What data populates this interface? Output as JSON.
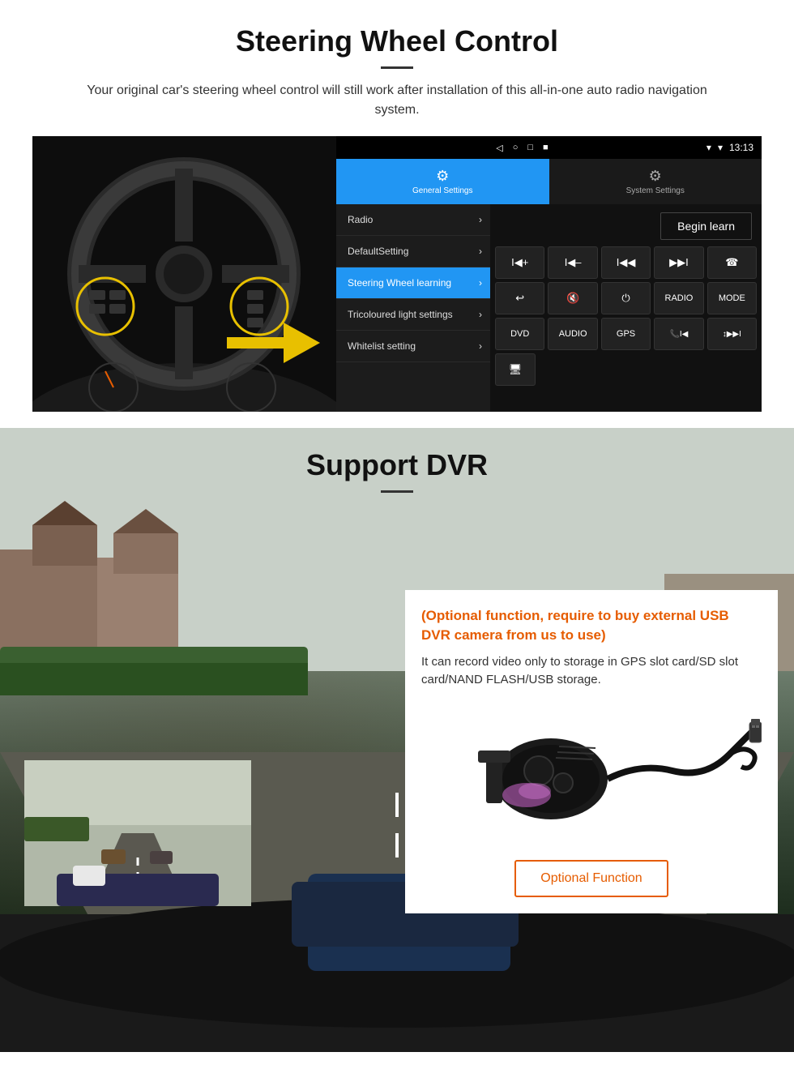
{
  "page": {
    "section1": {
      "title": "Steering Wheel Control",
      "description": "Your original car's steering wheel control will still work after installation of this all-in-one auto radio navigation system.",
      "statusbar": {
        "time": "13:13",
        "nav_icons": [
          "◁",
          "○",
          "□",
          "■"
        ]
      },
      "tabs": [
        {
          "label": "General Settings",
          "icon": "⚙",
          "active": true
        },
        {
          "label": "System Settings",
          "icon": "🔧",
          "active": false
        }
      ],
      "menu_items": [
        {
          "label": "Radio",
          "active": false
        },
        {
          "label": "DefaultSetting",
          "active": false
        },
        {
          "label": "Steering Wheel learning",
          "active": true
        },
        {
          "label": "Tricoloured light settings",
          "active": false
        },
        {
          "label": "Whitelist setting",
          "active": false
        }
      ],
      "begin_learn_btn": "Begin learn",
      "control_rows": [
        [
          "I◀+",
          "I◀–",
          "I◀◀",
          "▶▶I",
          "☎"
        ],
        [
          "↩",
          "🔇×",
          "⏻",
          "RADIO",
          "MODE"
        ],
        [
          "DVD",
          "AUDIO",
          "GPS",
          "📞I◀",
          "↕▶▶I"
        ]
      ]
    },
    "section2": {
      "title": "Support DVR",
      "info_title": "(Optional function, require to buy external USB DVR camera from us to use)",
      "info_text": "It can record video only to storage in GPS slot card/SD slot card/NAND FLASH/USB storage.",
      "optional_function_btn": "Optional Function"
    }
  }
}
